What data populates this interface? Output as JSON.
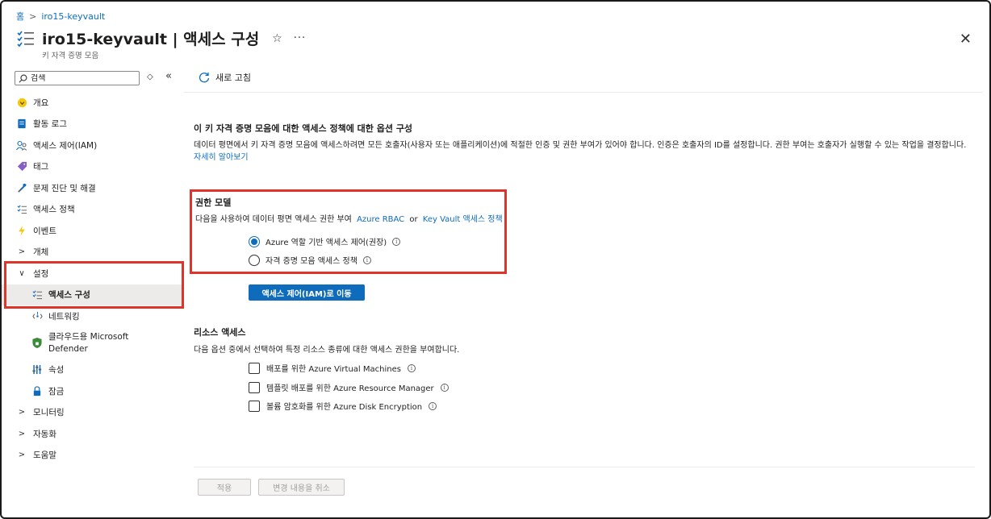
{
  "breadcrumb": {
    "home": "홈",
    "resource": "iro15-keyvault"
  },
  "header": {
    "title": "iro15-keyvault | 액세스 구성",
    "subtitle": "키 자격 증명 모음"
  },
  "sidebar": {
    "search_placeholder": "검색",
    "items": [
      {
        "label": "개요",
        "icon": "overview-icon"
      },
      {
        "label": "활동 로그",
        "icon": "activity-log-icon"
      },
      {
        "label": "액세스 제어(IAM)",
        "icon": "iam-icon"
      },
      {
        "label": "태그",
        "icon": "tag-icon"
      },
      {
        "label": "문제 진단 및 해결",
        "icon": "diagnose-icon"
      },
      {
        "label": "액세스 정책",
        "icon": "access-policy-icon"
      },
      {
        "label": "이벤트",
        "icon": "lightning-icon"
      },
      {
        "label": "개체",
        "icon": "chevron-right-icon"
      },
      {
        "label": "설정",
        "icon": "chevron-down-icon"
      },
      {
        "label": "액세스 구성",
        "icon": "access-config-icon"
      },
      {
        "label": "네트워킹",
        "icon": "networking-icon"
      },
      {
        "label": "클라우드용 Microsoft Defender",
        "icon": "defender-icon"
      },
      {
        "label": "속성",
        "icon": "properties-icon"
      },
      {
        "label": "잠금",
        "icon": "lock-icon"
      },
      {
        "label": "모니터링",
        "icon": "chevron-right-icon"
      },
      {
        "label": "자동화",
        "icon": "chevron-right-icon"
      },
      {
        "label": "도움말",
        "icon": "chevron-right-icon"
      }
    ]
  },
  "toolbar": {
    "refresh_label": "새로 고침"
  },
  "main": {
    "heading": "이 키 자격 증명 모음에 대한 액세스 정책에 대한 옵션 구성",
    "description": "데이터 평면에서 키 자격 증명 모음에 액세스하려면 모든 호출자(사용자 또는 애플리케이션)에 적절한 인증 및 권한 부여가 있어야 합니다. 인증은 호출자의 ID를 설정합니다. 권한 부여는 호출자가 실행할 수 있는 작업을 결정합니다.",
    "learn_more": "자세히 알아보기",
    "permission_model": {
      "title": "권한 모델",
      "text_prefix": "다음을 사용하여 데이터 평면 액세스 권한 부여",
      "link_rbac": "Azure RBAC",
      "or": "or",
      "link_policy": "Key Vault 액세스 정책",
      "options": [
        {
          "label": "Azure 역할 기반 액세스 제어(권장)",
          "checked": true
        },
        {
          "label": "자격 증명 모음 액세스 정책",
          "checked": false
        }
      ]
    },
    "goto_iam_button": "액세스 제어(IAM)로 이동",
    "resource_access": {
      "title": "리소스 액세스",
      "description": "다음 옵션 중에서 선택하여 특정 리소스 종류에 대한 액세스 권한을 부여합니다.",
      "options": [
        {
          "label": "배포를 위한 Azure Virtual Machines",
          "checked": false
        },
        {
          "label": "템플릿 배포를 위한 Azure Resource Manager",
          "checked": false
        },
        {
          "label": "볼륨 암호화를 위한 Azure Disk Encryption",
          "checked": false
        }
      ]
    },
    "apply_button": "적용",
    "discard_button": "변경 내용을 취소"
  },
  "colors": {
    "accent": "#0f6cbd",
    "highlight": "#e0332a"
  }
}
